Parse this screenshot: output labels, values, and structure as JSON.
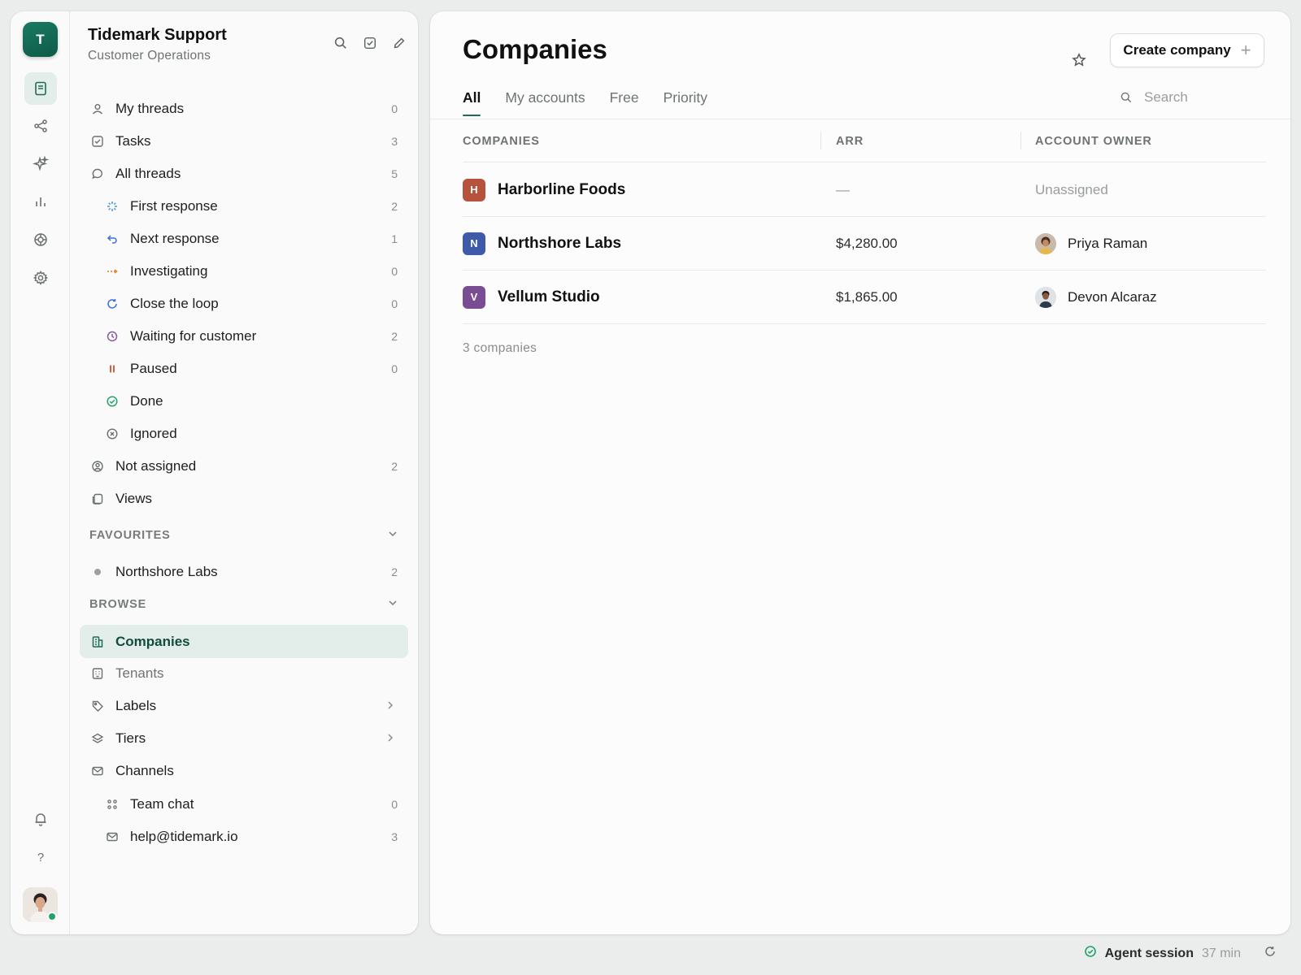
{
  "workspace": {
    "initial": "T",
    "name": "Tidemark Support",
    "subtitle": "Customer Operations"
  },
  "rail": {
    "help_label": "?"
  },
  "nav": [
    {
      "label": "My threads",
      "count": "0",
      "icon": "user-icon"
    },
    {
      "label": "Tasks",
      "count": "3",
      "icon": "checkbox-icon"
    },
    {
      "label": "All threads",
      "count": "5",
      "icon": "chat-bubble-icon"
    },
    {
      "label": "First response",
      "count": "2",
      "icon": "sparkle-icon"
    },
    {
      "label": "Next response",
      "count": "1",
      "icon": "reply-icon"
    },
    {
      "label": "Investigating",
      "count": "0",
      "icon": "dashed-arrow-icon"
    },
    {
      "label": "Close the loop",
      "count": "0",
      "icon": "refresh-icon"
    },
    {
      "label": "Waiting for customer",
      "count": "2",
      "icon": "clock-icon"
    },
    {
      "label": "Paused",
      "count": "0",
      "icon": "pause-icon"
    },
    {
      "label": "Done",
      "count": "",
      "icon": "check-circle-icon"
    },
    {
      "label": "Ignored",
      "count": "",
      "icon": "x-circle-icon"
    },
    {
      "label": "Not assigned",
      "count": "2",
      "icon": "user-circle-icon"
    },
    {
      "label": "Views",
      "count": "",
      "icon": "views-icon"
    }
  ],
  "favourites": {
    "title": "FAVOURITES",
    "items": [
      {
        "label": "Northshore Labs",
        "count": "2"
      }
    ]
  },
  "browse": {
    "title": "BROWSE",
    "items": [
      {
        "label": "Companies"
      },
      {
        "label": "Tenants"
      },
      {
        "label": "Labels"
      },
      {
        "label": "Tiers"
      },
      {
        "label": "Channels"
      },
      {
        "label": "Team chat",
        "count": "0"
      },
      {
        "label": "help@tidemark.io",
        "count": "3"
      }
    ]
  },
  "page": {
    "title": "Companies",
    "create_label": "Create company",
    "tabs": [
      "All",
      "My accounts",
      "Free",
      "Priority"
    ],
    "search_placeholder": "Search"
  },
  "table": {
    "headers": [
      "COMPANIES",
      "ARR",
      "ACCOUNT OWNER"
    ],
    "rows": [
      {
        "initial": "H",
        "name": "Harborline Foods",
        "arr": "—",
        "owner": "Unassigned",
        "color": "#b5533c"
      },
      {
        "initial": "N",
        "name": "Northshore Labs",
        "arr": "$4,280.00",
        "owner": "Priya Raman",
        "color": "#3e5aa8"
      },
      {
        "initial": "V",
        "name": "Vellum Studio",
        "arr": "$1,865.00",
        "owner": "Devon Alcaraz",
        "color": "#7a4c93"
      }
    ],
    "count_label": "3 companies"
  },
  "status": {
    "label": "Agent session",
    "time": "37 min"
  },
  "colors": {
    "accent": "#1f6b57",
    "active_bg": "#e3eeea"
  }
}
